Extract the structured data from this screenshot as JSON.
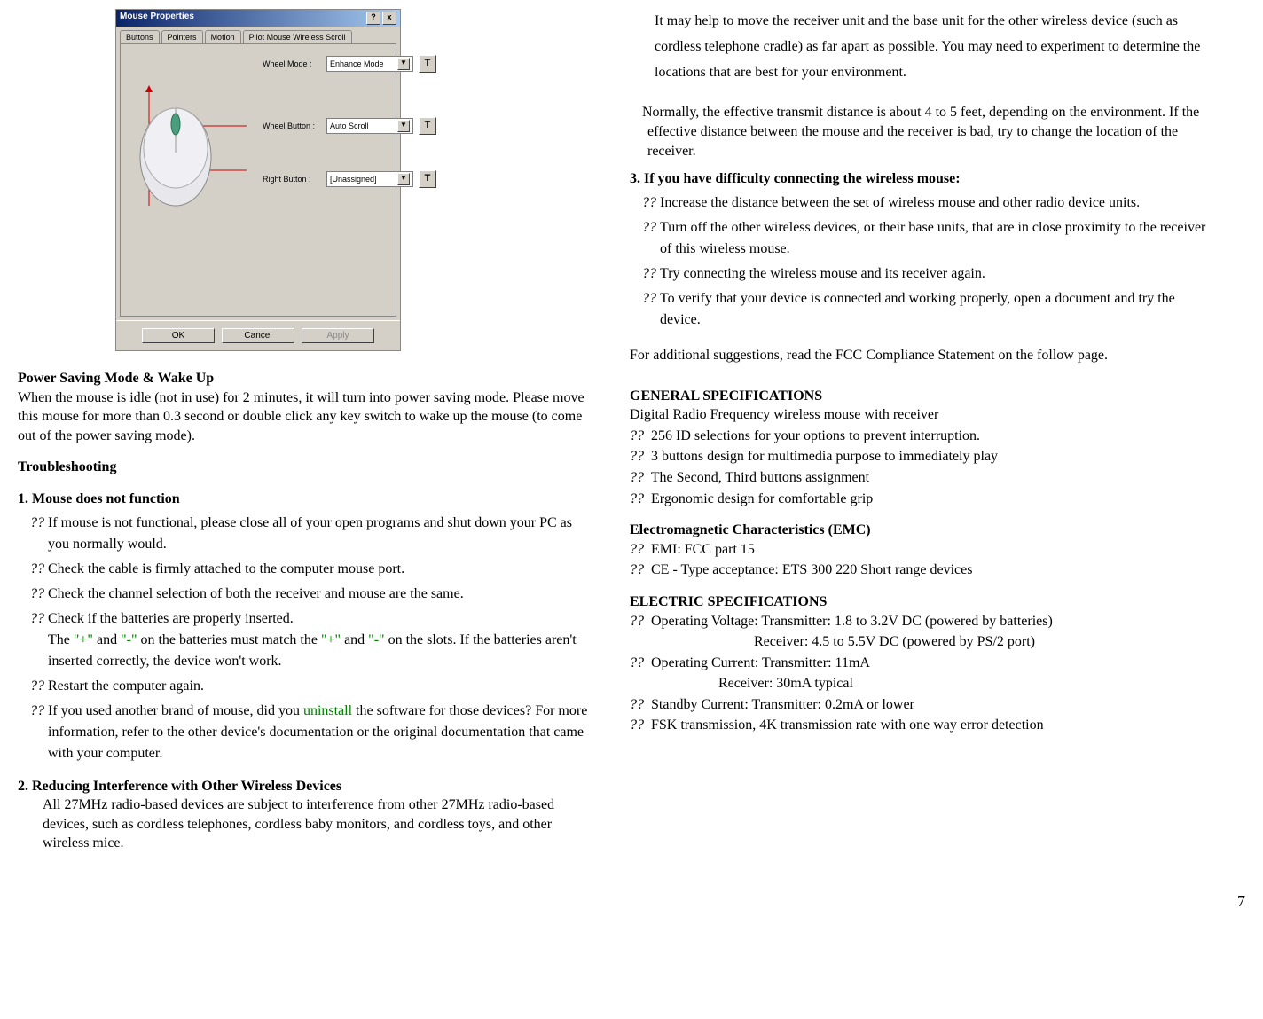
{
  "dialog": {
    "title": "Mouse Properties",
    "tabs": [
      "Buttons",
      "Pointers",
      "Motion",
      "Pilot  Mouse Wireless Scroll"
    ],
    "wheelModeLabel": "Wheel Mode :",
    "wheelModeValue": "Enhance Mode",
    "wheelButtonLabel": "Wheel Button :",
    "wheelButtonValue": "Auto Scroll",
    "rightButtonLabel": "Right Button :",
    "rightButtonValue": "[Unassigned]",
    "ok": "OK",
    "cancel": "Cancel",
    "apply": "Apply",
    "help": "?",
    "close": "x",
    "t": "T"
  },
  "left": {
    "h_power": "Power Saving Mode & Wake Up",
    "p_power": "When the mouse is idle (not in use) for 2 minutes, it will turn into power saving mode. Please move this mouse for more than 0.3 second or double click any key switch to wake up the mouse (to come out of  the power saving mode).",
    "h_trouble": "Troubleshooting",
    "h_t1": "1. Mouse does not function",
    "t1_a": "If mouse is not functional, please close all of your open programs and shut down your PC as you normally would.",
    "t1_b": "Check the cable is firmly attached to the computer mouse port.",
    "t1_c": "Check the channel selection of both the receiver and mouse are the same.",
    "t1_d": "Check if the batteries are properly inserted.",
    "t1_d2a": "The ",
    "t1_d2b": " and ",
    "t1_d2c": " on the batteries must match the ",
    "t1_d2d": " and ",
    "t1_d2e": " on the slots. If the batteries aren't inserted correctly, the device won't work.",
    "plus": "\"+\"",
    "minus": "\"-\"",
    "t1_e": "Restart the computer again.",
    "t1_f1": "If you used another brand of mouse, did you ",
    "t1_f2": "uninstall",
    "t1_f3": " the software for those devices? For more information, refer to the other device's documentation or the original documentation that came with your computer.",
    "h_t2": "2. Reducing Interference with Other Wireless Devices",
    "t2_p": "All 27MHz radio-based devices are subject to interference from other 27MHz radio-based devices, such as cordless telephones, cordless baby monitors, and cordless toys, and other wireless mice."
  },
  "right": {
    "p1": "It may help to move the receiver unit and the base unit for the other wireless device (such as cordless telephone cradle) as far apart as possible. You may need to experiment to determine the locations that are best for your environment.",
    "p2": "Normally, the effective transmit distance is about 4 to 5 feet, depending on the environment. If the effective distance between the mouse and the receiver is bad, try to change the location of the receiver.",
    "h_t3": "3. If you have difficulty connecting the wireless mouse:",
    "t3_a": "Increase the distance between the set of wireless mouse and other radio device units.",
    "t3_b": "Turn off the other wireless devices, or their base units, that are in close proximity to the receiver of this wireless mouse.",
    "t3_c": "Try connecting the wireless mouse and its receiver again.",
    "t3_d": "To verify that your device is connected and working properly, open a document and try the device.",
    "p3": "For additional suggestions, read the FCC Compliance Statement on the follow page.",
    "h_gen": "GENERAL SPECIFICATIONS",
    "gen_sub": " Digital Radio Frequency wireless mouse with receiver",
    "gen_a": "256 ID selections for your options to prevent interruption.",
    "gen_b": "3 buttons design for multimedia purpose to immediately play",
    "gen_c": "The Second, Third buttons assignment",
    "gen_d": "Ergonomic design for comfortable grip",
    "h_emc": "Electromagnetic Characteristics (EMC)",
    "emc_a": "EMI: FCC part 15",
    "emc_b": "CE - Type acceptance: ETS 300 220 Short range devices",
    "h_elec": "ELECTRIC SPECIFICATIONS",
    "elec_a": "Operating Voltage:   Transmitter: 1.8 to 3.2V DC (powered by batteries)",
    "elec_a2": "Receiver: 4.5 to 5.5V DC (powered by PS/2 port)",
    "elec_b": "Operating Current:   Transmitter: 11mA",
    "elec_b2": "Receiver: 30mA typical",
    "elec_c": "Standby Current:          Transmitter: 0.2mA or lower",
    "elec_d": "FSK transmission, 4K transmission rate with one way error detection"
  },
  "bulletMark": "??",
  "pageNumber": "7"
}
